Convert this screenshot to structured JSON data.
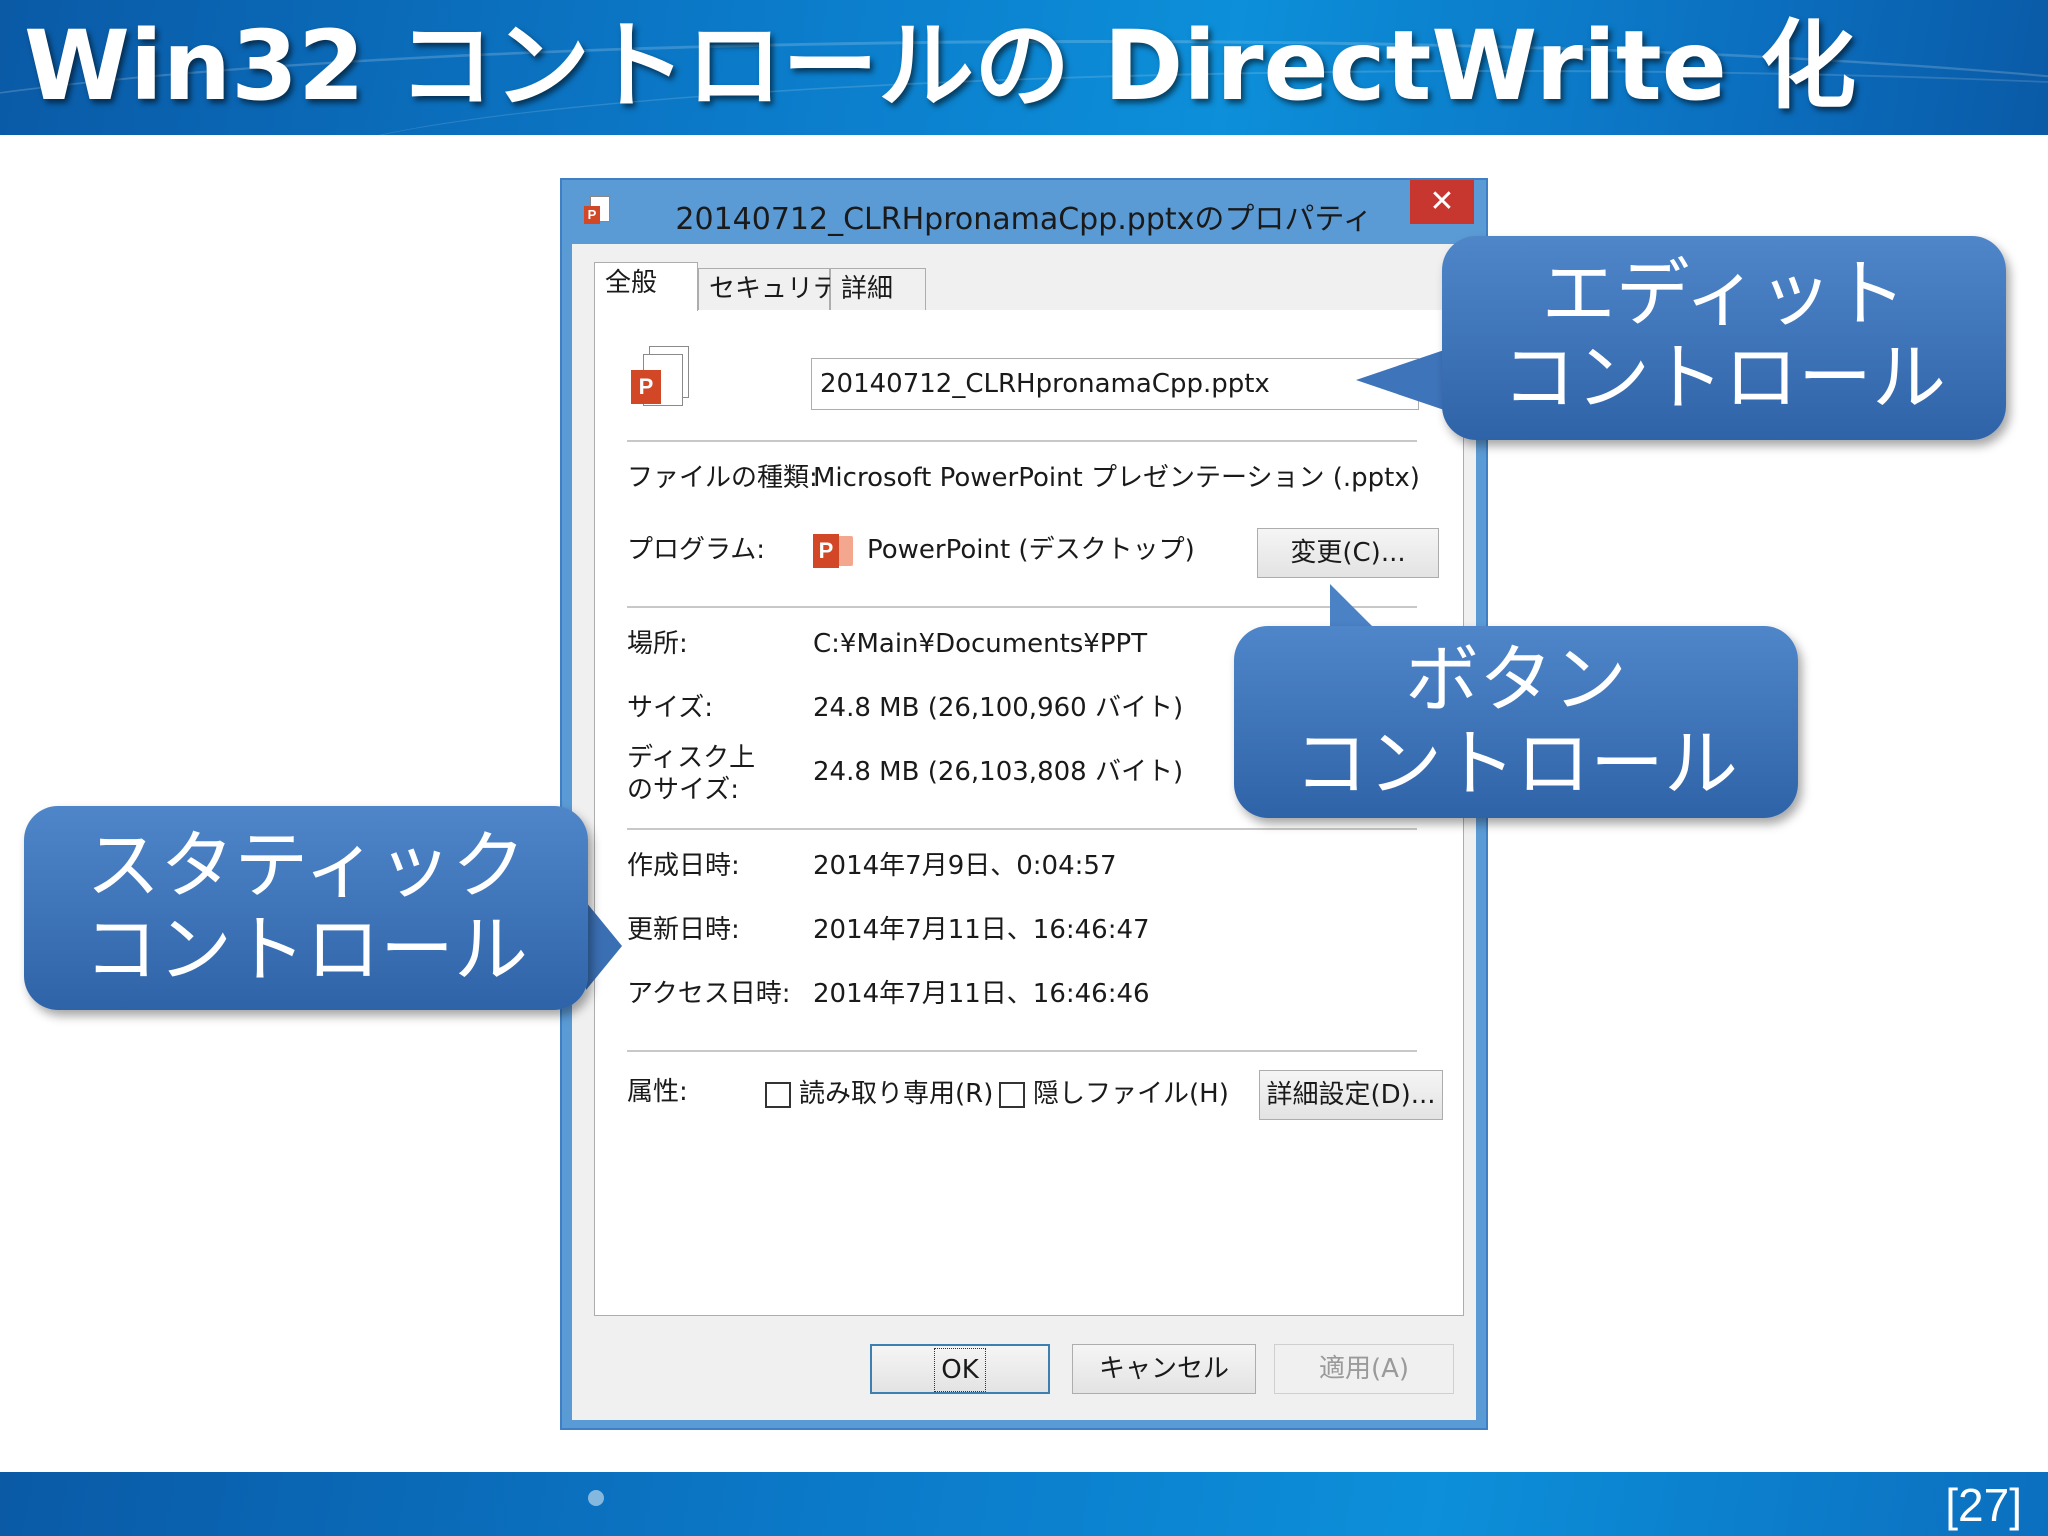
{
  "slide": {
    "title": "Win32 コントロールの DirectWrite 化",
    "page_number": "[27]"
  },
  "window": {
    "title": "20140712_CLRHpronamaCpp.pptxのプロパティ",
    "close_glyph": "✕"
  },
  "tabs": [
    {
      "label": "全般",
      "active": true
    },
    {
      "label": "セキュリティ",
      "active": false
    },
    {
      "label": "詳細",
      "active": false
    }
  ],
  "general": {
    "filename_value": "20140712_CLRHpronamaCpp.pptx",
    "file_type_label": "ファイルの種類:",
    "file_type_value": "Microsoft PowerPoint プレゼンテーション (.pptx)",
    "program_label": "プログラム:",
    "program_value": "PowerPoint (デスクトップ)",
    "change_button": "変更(C)...",
    "location_label": "場所:",
    "location_value": "C:¥Main¥Documents¥PPT",
    "size_label": "サイズ:",
    "size_value": "24.8 MB (26,100,960 バイト)",
    "disk_size_label_1": "ディスク上",
    "disk_size_label_2": "のサイズ:",
    "disk_size_value": "24.8 MB (26,103,808 バイト)",
    "created_label": "作成日時:",
    "created_value": "2014年7月9日、0:04:57",
    "modified_label": "更新日時:",
    "modified_value": "2014年7月11日、16:46:47",
    "accessed_label": "アクセス日時:",
    "accessed_value": "2014年7月11日、16:46:46",
    "attributes_label": "属性:",
    "readonly_label": "読み取り専用(R)",
    "hidden_label": "隠しファイル(H)",
    "advanced_button": "詳細設定(D)..."
  },
  "footer_buttons": {
    "ok": "OK",
    "cancel": "キャンセル",
    "apply": "適用(A)"
  },
  "icon_badge": "P",
  "callouts": {
    "edit_line1": "エディット",
    "edit_line2": "コントロール",
    "button_line1": "ボタン",
    "button_line2": "コントロール",
    "static_line1": "スタティック",
    "static_line2": "コントロール"
  },
  "colors": {
    "header_blue": "#0b79c8",
    "window_border": "#5b9bd5",
    "close_red": "#c7372f",
    "callout_blue": "#3d72b8",
    "powerpoint_orange": "#d24726"
  }
}
